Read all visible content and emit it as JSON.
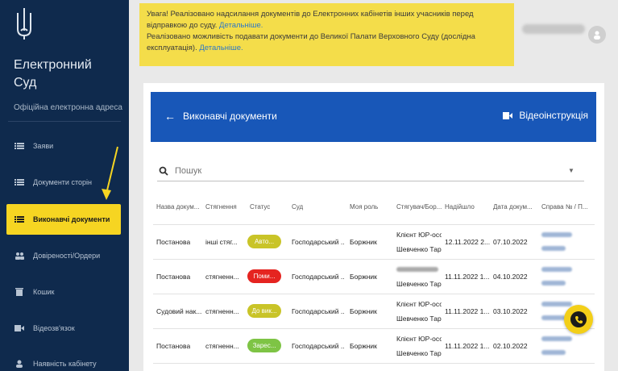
{
  "sidebar": {
    "brand_line1": "Електронний",
    "brand_line2": "Суд",
    "brand_sub": "Офіційна електронна адреса",
    "items": [
      {
        "label": "Заяви",
        "icon": "list-icon"
      },
      {
        "label": "Документи сторін",
        "icon": "list-icon"
      },
      {
        "label": "Виконавчі документи",
        "icon": "list-icon",
        "active": true
      },
      {
        "label": "Довіреності/Ордери",
        "icon": "people-icon"
      },
      {
        "label": "Кошик",
        "icon": "trash-icon"
      },
      {
        "label": "Відеозв'язок",
        "icon": "video-icon"
      },
      {
        "label": "Наявність кабінету",
        "icon": "person-icon"
      }
    ]
  },
  "notice": {
    "line1": "Увага! Реалізовано надсилання документів до Електронних кабінетів інших учасників перед відправкою до суду. ",
    "link1": "Детальніше.",
    "line2": "Реалізовано можливість подавати документи до Великої Палати Верховного Суду (дослідна експлуатація). ",
    "link2": "Детальніше."
  },
  "header": {
    "back": "←",
    "title": "Виконавчі документи",
    "video_label": "Відеоінструкція"
  },
  "search": {
    "placeholder": "Пошук"
  },
  "table": {
    "columns": [
      "Назва докум...",
      "Стягнення",
      "Статус",
      "Суд",
      "Моя роль",
      "Стягувач/Бор...",
      "Надійшло",
      "Дата докум...",
      "Справа № / П..."
    ],
    "rows": [
      {
        "name": "Постанова",
        "recovery": "інші стяг...",
        "status": "Авто...",
        "status_color": "#c9c428",
        "court": "Господарський ...",
        "role": "Боржник",
        "creditor1": "Клієнт ЮР-осо",
        "creditor2": "Шевченко Тар",
        "received": "12.11.2022 2...",
        "doc_date": "07.10.2022"
      },
      {
        "name": "Постанова",
        "recovery": "стягненн...",
        "status": "Поми...",
        "status_color": "#e52420",
        "court": "Господарський ...",
        "role": "Боржник",
        "creditor1": "",
        "creditor2": "Шевченко Тар",
        "received": "11.11.2022 1...",
        "doc_date": "04.10.2022"
      },
      {
        "name": "Судовий нак...",
        "recovery": "стягненн...",
        "status": "До вик...",
        "status_color": "#c9c428",
        "court": "Господарський ...",
        "role": "Боржник",
        "creditor1": "Клієнт ЮР-осо",
        "creditor2": "Шевченко Тар",
        "received": "11.11.2022 1...",
        "doc_date": "03.10.2022"
      },
      {
        "name": "Постанова",
        "recovery": "стягненн...",
        "status": "Зарес...",
        "status_color": "#7ec445",
        "court": "Господарський ...",
        "role": "Боржник",
        "creditor1": "Клієнт ЮР-осо",
        "creditor2": "Шевченко Тар",
        "received": "11.11.2022 1...",
        "doc_date": "02.10.2022"
      }
    ]
  },
  "colors": {
    "sidebar_bg": "#0f2a4d",
    "accent_yellow": "#f6d522",
    "header_blue": "#1857b8"
  }
}
